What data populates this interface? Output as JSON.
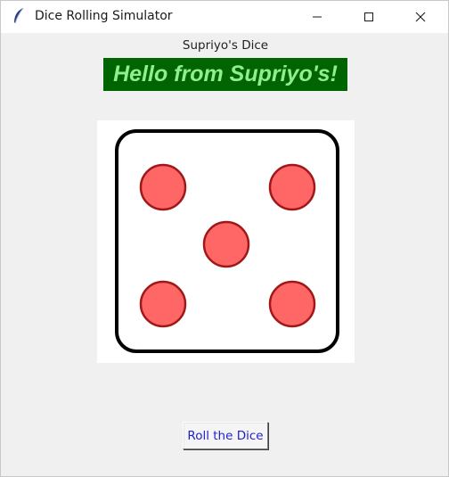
{
  "window": {
    "title": "Dice Rolling Simulator",
    "icon": "feather-icon",
    "controls": [
      "minimize-icon",
      "maximize-icon",
      "close-icon"
    ]
  },
  "main": {
    "heading": "Supriyo's Dice",
    "banner_text": "Hello from Supriyo's!",
    "banner_bg_color": "#006400",
    "banner_text_color": "#90ee90",
    "dice": {
      "face_value": 5,
      "pip_color": "#ff6666",
      "pip_outline_color": "#a01818"
    },
    "roll_button_label": "Roll the Dice",
    "roll_button_text_color": "#1f1fcf"
  }
}
